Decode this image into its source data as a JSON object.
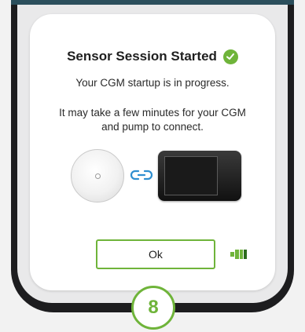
{
  "dialog": {
    "title": "Sensor Session Started",
    "message_1": "Your CGM startup is in progress.",
    "message_2": "It may take a few minutes for your CGM and pump to connect.",
    "ok_label": "Ok"
  },
  "step": {
    "number": "8"
  },
  "icons": {
    "title_status": "check-circle-icon",
    "sensor": "cgm-sensor-icon",
    "link": "link-icon",
    "pump": "insulin-pump-icon",
    "battery": "battery-icon"
  },
  "colors": {
    "accent_green": "#6fb43a",
    "link_blue": "#2f8fd0",
    "top_bar": "#2b4f5c",
    "device_frame": "#1d1d1f"
  }
}
